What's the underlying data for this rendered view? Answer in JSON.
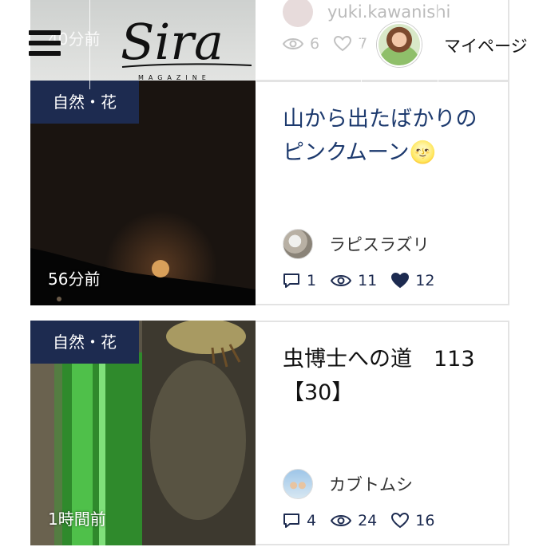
{
  "header": {
    "logo_text": "Sira",
    "logo_sub": "MAGAZINE",
    "mypage_label": "マイページ"
  },
  "top_card": {
    "age": "40分前",
    "author": "yuki.kawanishi",
    "views": "6",
    "likes": "7"
  },
  "cards": [
    {
      "category": "自然・花",
      "age": "56分前",
      "title": "山から出たばかりのピンクムーン🌝",
      "title_color": "#1d3a6e",
      "author": "ラピスラズリ",
      "comments": "1",
      "views": "11",
      "likes": "12",
      "liked": true
    },
    {
      "category": "自然・花",
      "age": "1時間前",
      "title": "虫博士への道　113【30】",
      "title_color": "#111111",
      "author": "カブトムシ",
      "comments": "4",
      "views": "24",
      "likes": "16",
      "liked": false
    }
  ],
  "colors": {
    "navy": "#1d2b50",
    "border": "#e3e3e3"
  }
}
